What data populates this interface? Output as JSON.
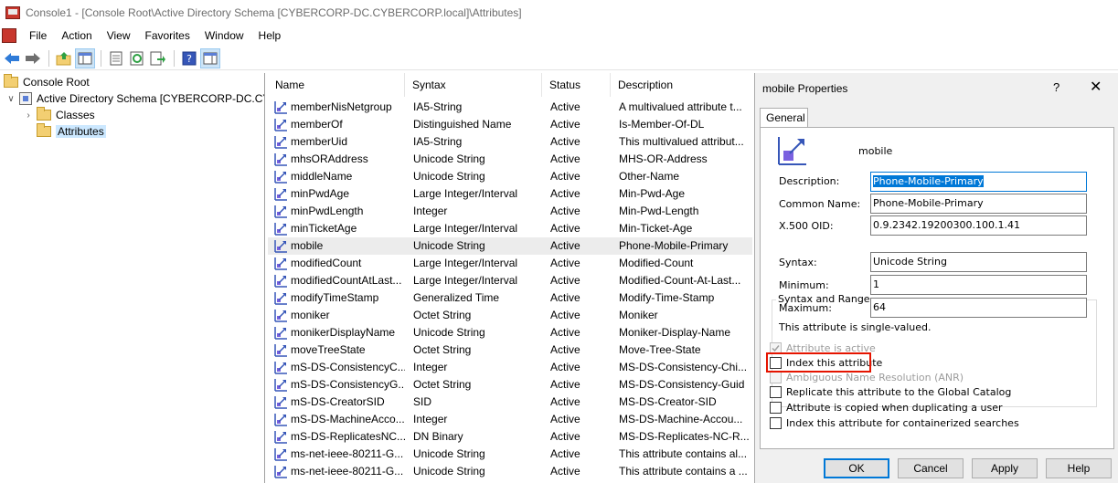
{
  "window": {
    "title": "Console1 - [Console Root\\Active Directory Schema [CYBERCORP-DC.CYBERCORP.local]\\Attributes]"
  },
  "menu": [
    "File",
    "Action",
    "View",
    "Favorites",
    "Window",
    "Help"
  ],
  "toolbar": {
    "icons": [
      "back-arrow-icon",
      "forward-arrow-icon",
      "up-folder-icon",
      "show-hide-tree-icon",
      "properties-icon",
      "refresh-icon",
      "export-list-icon",
      "help-icon",
      "show-hide-action-pane-icon"
    ]
  },
  "tree": {
    "items": [
      {
        "label": "Console Root"
      },
      {
        "label": "Active Directory Schema [CYBERCORP-DC.CYBERCORP.local]"
      },
      {
        "label": "Classes"
      },
      {
        "label": "Attributes"
      }
    ]
  },
  "list": {
    "columns": [
      "Name",
      "Syntax",
      "Status",
      "Description"
    ],
    "rows": [
      {
        "name": "memberNisNetgroup",
        "syntax": "IA5-String",
        "status": "Active",
        "description": "A multivalued attribute t..."
      },
      {
        "name": "memberOf",
        "syntax": "Distinguished Name",
        "status": "Active",
        "description": "Is-Member-Of-DL"
      },
      {
        "name": "memberUid",
        "syntax": "IA5-String",
        "status": "Active",
        "description": "This multivalued attribut..."
      },
      {
        "name": "mhsORAddress",
        "syntax": "Unicode String",
        "status": "Active",
        "description": "MHS-OR-Address"
      },
      {
        "name": "middleName",
        "syntax": "Unicode String",
        "status": "Active",
        "description": "Other-Name"
      },
      {
        "name": "minPwdAge",
        "syntax": "Large Integer/Interval",
        "status": "Active",
        "description": "Min-Pwd-Age"
      },
      {
        "name": "minPwdLength",
        "syntax": "Integer",
        "status": "Active",
        "description": "Min-Pwd-Length"
      },
      {
        "name": "minTicketAge",
        "syntax": "Large Integer/Interval",
        "status": "Active",
        "description": "Min-Ticket-Age"
      },
      {
        "name": "mobile",
        "syntax": "Unicode String",
        "status": "Active",
        "description": "Phone-Mobile-Primary"
      },
      {
        "name": "modifiedCount",
        "syntax": "Large Integer/Interval",
        "status": "Active",
        "description": "Modified-Count"
      },
      {
        "name": "modifiedCountAtLast...",
        "syntax": "Large Integer/Interval",
        "status": "Active",
        "description": "Modified-Count-At-Last..."
      },
      {
        "name": "modifyTimeStamp",
        "syntax": "Generalized Time",
        "status": "Active",
        "description": "Modify-Time-Stamp"
      },
      {
        "name": "moniker",
        "syntax": "Octet String",
        "status": "Active",
        "description": "Moniker"
      },
      {
        "name": "monikerDisplayName",
        "syntax": "Unicode String",
        "status": "Active",
        "description": "Moniker-Display-Name"
      },
      {
        "name": "moveTreeState",
        "syntax": "Octet String",
        "status": "Active",
        "description": "Move-Tree-State"
      },
      {
        "name": "mS-DS-ConsistencyC...",
        "syntax": "Integer",
        "status": "Active",
        "description": "MS-DS-Consistency-Chi..."
      },
      {
        "name": "mS-DS-ConsistencyG...",
        "syntax": "Octet String",
        "status": "Active",
        "description": "MS-DS-Consistency-Guid"
      },
      {
        "name": "mS-DS-CreatorSID",
        "syntax": "SID",
        "status": "Active",
        "description": "MS-DS-Creator-SID"
      },
      {
        "name": "mS-DS-MachineAcco...",
        "syntax": "Integer",
        "status": "Active",
        "description": "MS-DS-Machine-Accou..."
      },
      {
        "name": "mS-DS-ReplicatesNC...",
        "syntax": "DN Binary",
        "status": "Active",
        "description": "MS-DS-Replicates-NC-R..."
      },
      {
        "name": "ms-net-ieee-80211-G...",
        "syntax": "Unicode String",
        "status": "Active",
        "description": "This attribute contains al..."
      },
      {
        "name": "ms-net-ieee-80211-G...",
        "syntax": "Unicode String",
        "status": "Active",
        "description": "This attribute contains a ..."
      }
    ]
  },
  "dialog": {
    "title": "mobile Properties",
    "help": "?",
    "close": "✕",
    "tab": "General",
    "object_name": "mobile",
    "description_label": "Description:",
    "description_value": "Phone-Mobile-Primary",
    "common_name_label": "Common Name:",
    "common_name_value": "Phone-Mobile-Primary",
    "oid_label": "X.500 OID:",
    "oid_value": "0.9.2342.19200300.100.1.41",
    "syntax_group": "Syntax and Range",
    "syntax_label": "Syntax:",
    "syntax_value": "Unicode String",
    "minimum_label": "Minimum:",
    "minimum_value": "1",
    "maximum_label": "Maximum:",
    "maximum_value": "64",
    "single_valued_note": "This attribute is single-valued.",
    "checkboxes": [
      {
        "label": "Attribute is active",
        "checked": true,
        "disabled": true
      },
      {
        "label": "Index this attribute",
        "checked": false,
        "disabled": false
      },
      {
        "label": "Ambiguous Name Resolution (ANR)",
        "checked": false,
        "disabled": true
      },
      {
        "label": "Replicate this attribute to the Global Catalog",
        "checked": false,
        "disabled": false
      },
      {
        "label": "Attribute is copied when duplicating a user",
        "checked": false,
        "disabled": false
      },
      {
        "label": "Index this attribute for containerized searches",
        "checked": false,
        "disabled": false
      }
    ],
    "buttons": {
      "ok": "OK",
      "cancel": "Cancel",
      "apply": "Apply",
      "help": "Help"
    }
  }
}
